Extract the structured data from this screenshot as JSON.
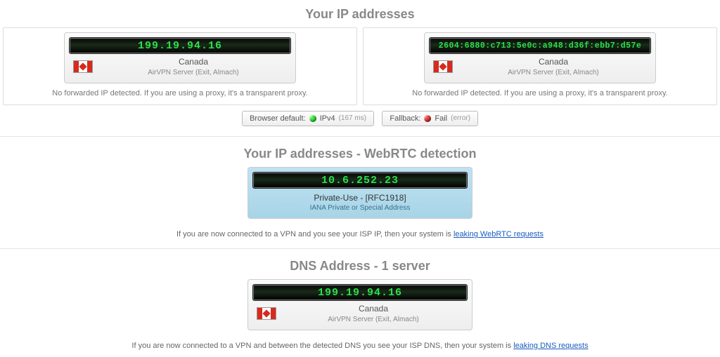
{
  "headings": {
    "ip": "Your IP addresses",
    "webrtc": "Your IP addresses - WebRTC detection",
    "dns": "DNS Address - 1 server"
  },
  "ipv4": {
    "ip": "199.19.94.16",
    "location": "Canada",
    "server": "AirVPN Server (Exit, Almach)",
    "note": "No forwarded IP detected. If you are using a proxy, it's a transparent proxy."
  },
  "ipv6": {
    "ip": "2604:6880:c713:5e0c:a948:d36f:ebb7:d57e",
    "location": "Canada",
    "server": "AirVPN Server (Exit, Almach)",
    "note": "No forwarded IP detected. If you are using a proxy, it's a transparent proxy."
  },
  "status": {
    "browser_default_label": "Browser default:",
    "browser_default_value": "IPv4",
    "browser_default_ms": "(167 ms)",
    "fallback_label": "Fallback:",
    "fallback_value": "Fail",
    "fallback_detail": "(error)"
  },
  "webrtc": {
    "ip": "10.6.252.23",
    "title": "Private-Use - [RFC1918]",
    "subtitle": "IANA Private or Special Address",
    "note_pre": "If you are now connected to a VPN and you see your ISP IP, then your system is ",
    "note_link": "leaking WebRTC requests"
  },
  "dns": {
    "ip": "199.19.94.16",
    "location": "Canada",
    "server": "AirVPN Server (Exit, Almach)",
    "note_pre": "If you are now connected to a VPN and between the detected DNS you see your ISP DNS, then your system is ",
    "note_link": "leaking DNS requests"
  }
}
